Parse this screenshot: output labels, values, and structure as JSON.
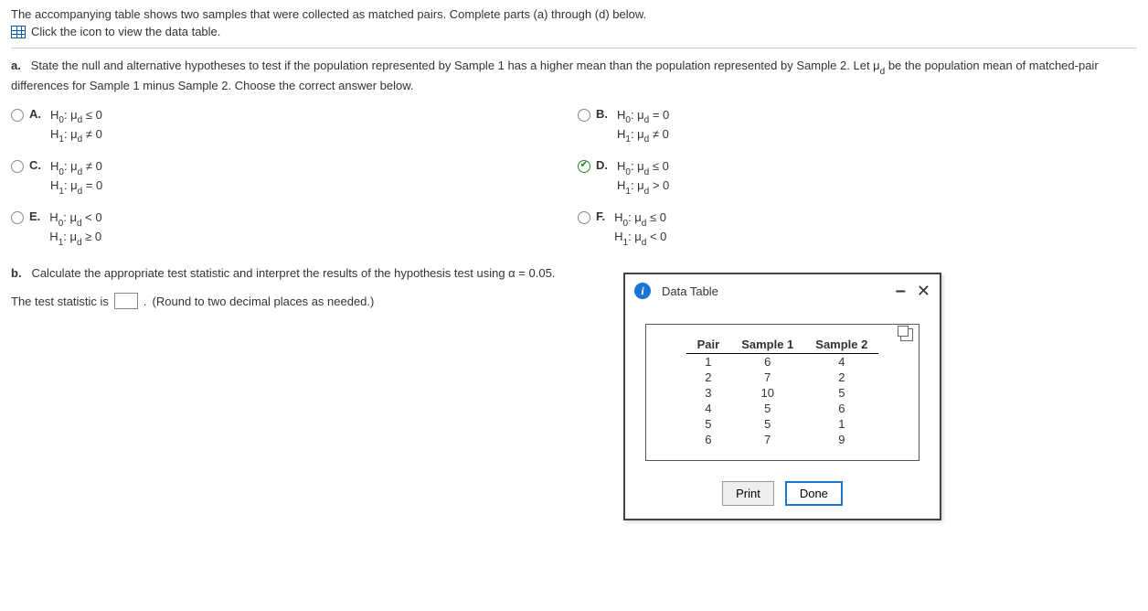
{
  "intro": "The accompanying table shows two samples that were collected as matched pairs. Complete parts (a) through (d) below.",
  "icon_link_text": "Click the icon to view the data table.",
  "part_a": {
    "label": "a.",
    "prompt": "State the null and alternative hypotheses to test if the population represented by Sample 1 has a higher mean than the population represented by Sample 2. Let μ_d be the population mean of matched-pair differences for Sample 1 minus Sample 2. Choose the correct answer below."
  },
  "choices": {
    "A": {
      "letter": "A.",
      "h0": "H₀: μ_d ≤ 0",
      "h1": "H₁: μ_d ≠ 0",
      "selected": false
    },
    "B": {
      "letter": "B.",
      "h0": "H₀: μ_d = 0",
      "h1": "H₁: μ_d ≠ 0",
      "selected": false
    },
    "C": {
      "letter": "C.",
      "h0": "H₀: μ_d ≠ 0",
      "h1": "H₁: μ_d = 0",
      "selected": false
    },
    "D": {
      "letter": "D.",
      "h0": "H₀: μ_d ≤ 0",
      "h1": "H₁: μ_d > 0",
      "selected": true
    },
    "E": {
      "letter": "E.",
      "h0": "H₀: μ_d < 0",
      "h1": "H₁: μ_d ≥ 0",
      "selected": false
    },
    "F": {
      "letter": "F.",
      "h0": "H₀: μ_d ≤ 0",
      "h1": "H₁: μ_d < 0",
      "selected": false
    }
  },
  "part_b": {
    "label": "b.",
    "prompt": "Calculate the appropriate test statistic and interpret the results of the hypothesis test using α = 0.05.",
    "stat_prefix": "The test statistic is",
    "stat_suffix": ".",
    "hint": "(Round to two decimal places as needed.)"
  },
  "dialog": {
    "title": "Data Table",
    "headers": {
      "pair": "Pair",
      "s1": "Sample 1",
      "s2": "Sample 2"
    },
    "rows": [
      {
        "pair": "1",
        "s1": "6",
        "s2": "4"
      },
      {
        "pair": "2",
        "s1": "7",
        "s2": "2"
      },
      {
        "pair": "3",
        "s1": "10",
        "s2": "5"
      },
      {
        "pair": "4",
        "s1": "5",
        "s2": "6"
      },
      {
        "pair": "5",
        "s1": "5",
        "s2": "1"
      },
      {
        "pair": "6",
        "s1": "7",
        "s2": "9"
      }
    ],
    "buttons": {
      "print": "Print",
      "done": "Done"
    }
  },
  "chart_data": {
    "type": "table",
    "columns": [
      "Pair",
      "Sample 1",
      "Sample 2"
    ],
    "rows": [
      [
        1,
        6,
        4
      ],
      [
        2,
        7,
        2
      ],
      [
        3,
        10,
        5
      ],
      [
        4,
        5,
        6
      ],
      [
        5,
        5,
        1
      ],
      [
        6,
        7,
        9
      ]
    ]
  }
}
